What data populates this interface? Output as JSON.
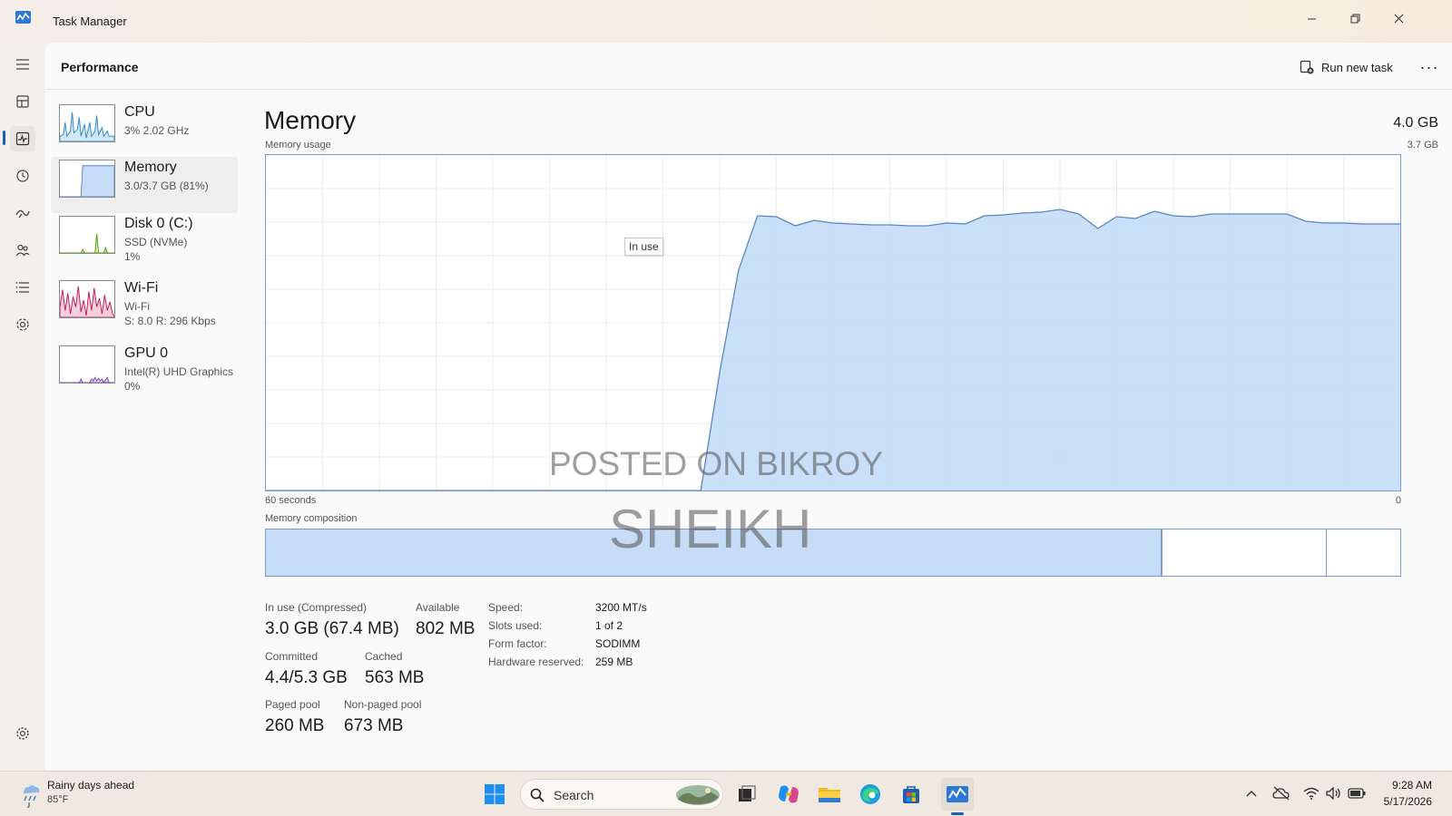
{
  "window": {
    "title": "Task Manager"
  },
  "header": {
    "page_title": "Performance",
    "run_new_task_label": "Run new task",
    "more_label": "···"
  },
  "devices": [
    {
      "name": "CPU",
      "line2": "3%  2.02 GHz",
      "line3": ""
    },
    {
      "name": "Memory",
      "line2": "3.0/3.7 GB (81%)",
      "line3": ""
    },
    {
      "name": "Disk 0 (C:)",
      "line2": "SSD (NVMe)",
      "line3": "1%"
    },
    {
      "name": "Wi-Fi",
      "line2": "Wi-Fi",
      "line3": "S: 8.0  R: 296 Kbps"
    },
    {
      "name": "GPU 0",
      "line2": "Intel(R) UHD Graphics",
      "line3": "0%"
    }
  ],
  "memory": {
    "title": "Memory",
    "total": "4.0 GB",
    "usage_label": "Memory usage",
    "usage_max": "3.7 GB",
    "axis_left": "60 seconds",
    "axis_right": "0",
    "tooltip": "In use",
    "composition_label": "Memory composition",
    "composition": {
      "in_use": 0.79,
      "standby": 0.145,
      "free": 0.065
    },
    "stats": {
      "in_use_label": "In use (Compressed)",
      "in_use_value": "3.0 GB (67.4 MB)",
      "available_label": "Available",
      "available_value": "802 MB",
      "committed_label": "Committed",
      "committed_value": "4.4/5.3 GB",
      "cached_label": "Cached",
      "cached_value": "563 MB",
      "paged_pool_label": "Paged pool",
      "paged_pool_value": "260 MB",
      "non_paged_pool_label": "Non-paged pool",
      "non_paged_pool_value": "673 MB"
    },
    "specs": {
      "speed_label": "Speed:",
      "speed_value": "3200 MT/s",
      "slots_label": "Slots used:",
      "slots_value": "1 of 2",
      "form_label": "Form factor:",
      "form_value": "SODIMM",
      "reserved_label": "Hardware reserved:",
      "reserved_value": "259 MB"
    }
  },
  "chart_data": {
    "type": "area",
    "x": [
      60,
      59,
      58,
      57,
      56,
      55,
      54,
      53,
      52,
      51,
      50,
      49,
      48,
      47,
      46,
      45,
      44,
      43,
      42,
      41,
      40,
      39,
      38,
      37,
      36,
      35,
      34,
      33,
      32,
      31,
      30,
      29,
      28,
      27,
      26,
      25,
      24,
      23,
      22,
      21,
      20,
      19,
      18,
      17,
      16,
      15,
      14,
      13,
      12,
      11,
      10,
      9,
      8,
      7,
      6,
      5,
      4,
      3,
      2,
      1,
      0
    ],
    "values": [
      0,
      0,
      0,
      0,
      0,
      0,
      0,
      0,
      0,
      0,
      0,
      0,
      0,
      0,
      0,
      0,
      0,
      0,
      0,
      0,
      0,
      0,
      0,
      0,
      1.3,
      2.43,
      3.03,
      3.02,
      2.92,
      2.98,
      2.95,
      2.94,
      2.93,
      2.93,
      2.92,
      2.92,
      2.95,
      2.94,
      3.03,
      3.04,
      3.06,
      3.07,
      3.1,
      3.05,
      2.89,
      3.02,
      3.0,
      3.08,
      3.03,
      3.02,
      3.05,
      3.05,
      3.05,
      3.05,
      3.05,
      2.97,
      2.95,
      2.95,
      2.94,
      2.94,
      2.94
    ],
    "ylim": [
      0,
      3.7
    ],
    "xlabel": "60 seconds",
    "series_color": "#c6dcf7",
    "line_color": "#5a86c0"
  },
  "watermark": {
    "line1": "POSTED ON BIKROY",
    "line2": "SHEIKH"
  },
  "taskbar": {
    "weather_text": "Rainy days ahead",
    "weather_temp": "85°F",
    "search_placeholder": "Search",
    "time": "9:28 AM",
    "date": "5/17/2026"
  }
}
